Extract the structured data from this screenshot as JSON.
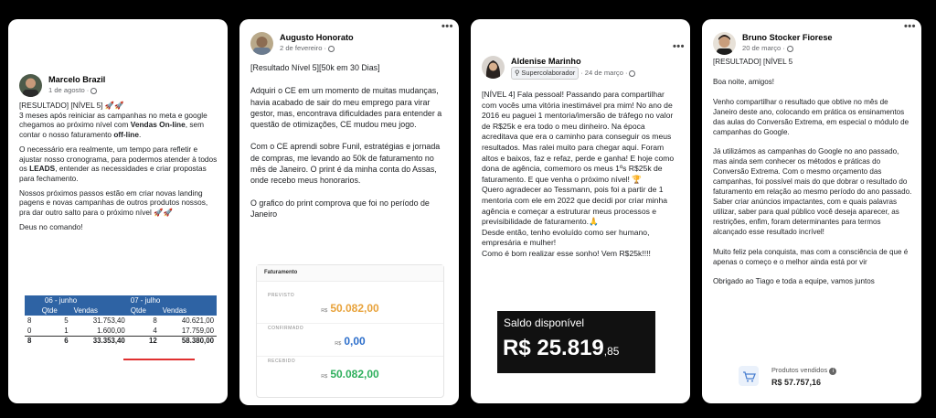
{
  "posts": [
    {
      "author": "Marcelo Brazil",
      "date": "1 de agosto",
      "paragraphs": [
        "[RESULTADO] [NÍVEL 5] 🚀🚀",
        "3 meses após reiniciar as campanhas no meta e google chegamos ao próximo nível com",
        "Vendas On-line",
        ", sem contar o nosso faturamento",
        "off-line",
        ".",
        "O necessário era realmente, um tempo para refletir e ajustar nosso cronograma, para podermos atender à todos os",
        "LEADS",
        ", entender as necessidades e criar propostas para fechamento.",
        "Nossos próximos passos estão em criar novas landing pagens e novas campanhas de outros produtos nossos, pra dar outro salto para o próximo nível 🚀🚀",
        "Deus no comando!"
      ],
      "table": {
        "months": [
          "06 - junho",
          "07 - julho"
        ],
        "subheaders": [
          "Qtde",
          "Vendas",
          "Qtde",
          "Vendas"
        ],
        "rows": [
          [
            "8",
            "5",
            "31.753,40",
            "8",
            "40.621,00"
          ],
          [
            "0",
            "1",
            "1.600,00",
            "4",
            "17.759,00"
          ],
          [
            "8",
            "6",
            "33.353,40",
            "12",
            "58.380,00"
          ]
        ]
      }
    },
    {
      "author": "Augusto Honorato",
      "date": "2 de fevereiro",
      "paragraphs": [
        "[Resultado Nível 5][50k em 30 Dias]",
        "Adquiri o CE em um momento de muitas mudanças, havia acabado de sair do meu emprego para virar gestor, mas, encontrava dificuldades para entender a questão de otimizações, CE mudou meu jogo.",
        "Com o CE aprendi sobre Funil, estratégias e jornada de compras, me levando ao 50k de faturamento no mês de Janeiro. O print é da minha conta do Assas, onde recebo meus honorarios.",
        "O grafico do print comprova que foi no período de Janeiro"
      ],
      "panel": {
        "title": "Faturamento",
        "rows": [
          {
            "label": "PREVISTO",
            "currency": "R$",
            "value": "50.082,00",
            "color": "#e8a23a"
          },
          {
            "label": "CONFIRMADO",
            "currency": "R$",
            "value": "0,00",
            "color": "#2c6ecb"
          },
          {
            "label": "RECEBIDO",
            "currency": "R$",
            "value": "50.082,00",
            "color": "#2eaf5c"
          }
        ]
      }
    },
    {
      "author": "Aldenise Marinho",
      "badge": "Supercolaborador",
      "date": "24 de março",
      "paragraphs": [
        "[NÍVEL 4] Fala pessoal! Passando para compartilhar com vocês uma vitória inestimável pra mim! No ano de 2016 eu paguei 1 mentoria/imersão de tráfego no valor de R$25k e era todo o meu dinheiro. Na época acreditava que era o caminho para conseguir os meus resultados. Mas ralei muito para chegar aqui. Foram altos e baixos, faz e refaz, perde e ganha! E hoje como dona de agência, comemoro os meus 1ºs R$25k de faturamento. E que venha o próximo nível! 🏆",
        "Quero agradecer ao Tessmann, pois foi a partir de 1 mentoria com ele em 2022 que decidi por criar minha agência e começar a estruturar meus processos e previsibilidade de faturamento.🙏",
        "Desde então, tenho evoluído como ser humano, empresária e mulher!",
        "Como é bom realizar esse sonho! Vem R$25k!!!!"
      ],
      "saldo": {
        "label": "Saldo disponível",
        "currency": "R$",
        "value": "25.819",
        "cents": ",85"
      }
    },
    {
      "author": "Bruno Stocker Fiorese",
      "date": "20 de março",
      "paragraphs": [
        "[RESULTADO] [NÍVEL 5",
        "Boa noite, amigos!",
        "Venho compartilhar o resultado que obtive no mês de Janeiro deste ano, colocando em prática os ensinamentos das aulas do Conversão Extrema, em especial o módulo de campanhas do Google.",
        "Já utilizámos as campanhas do Google no ano passado, mas ainda sem conhecer os métodos e práticas do Conversão Extrema. Com o mesmo orçamento das campanhas, foi possível mais do que dobrar o resultado do faturamento em relação ao mesmo período do ano passado. Saber criar anúncios impactantes, com e quais palavras utilizar, saber para qual público você deseja aparecer, as restrições, enfim, foram determinantes para termos alcançado esse resultado incrível!",
        "Muito feliz pela conquista, mas com a consciência de que é apenas o começo e o melhor ainda está por vir",
        "Obrigado ao Tiago e toda a equipe, vamos juntos"
      ],
      "sales": {
        "label": "Produtos vendidos",
        "value": "R$ 57.757,16"
      }
    }
  ],
  "colors": {
    "table_header": "#2e63a4",
    "underline": "#e03030",
    "background": "#000000"
  },
  "icons": [
    "globe-icon",
    "more-options-icon",
    "badge-icon",
    "shopping-cart-icon",
    "info-icon"
  ]
}
